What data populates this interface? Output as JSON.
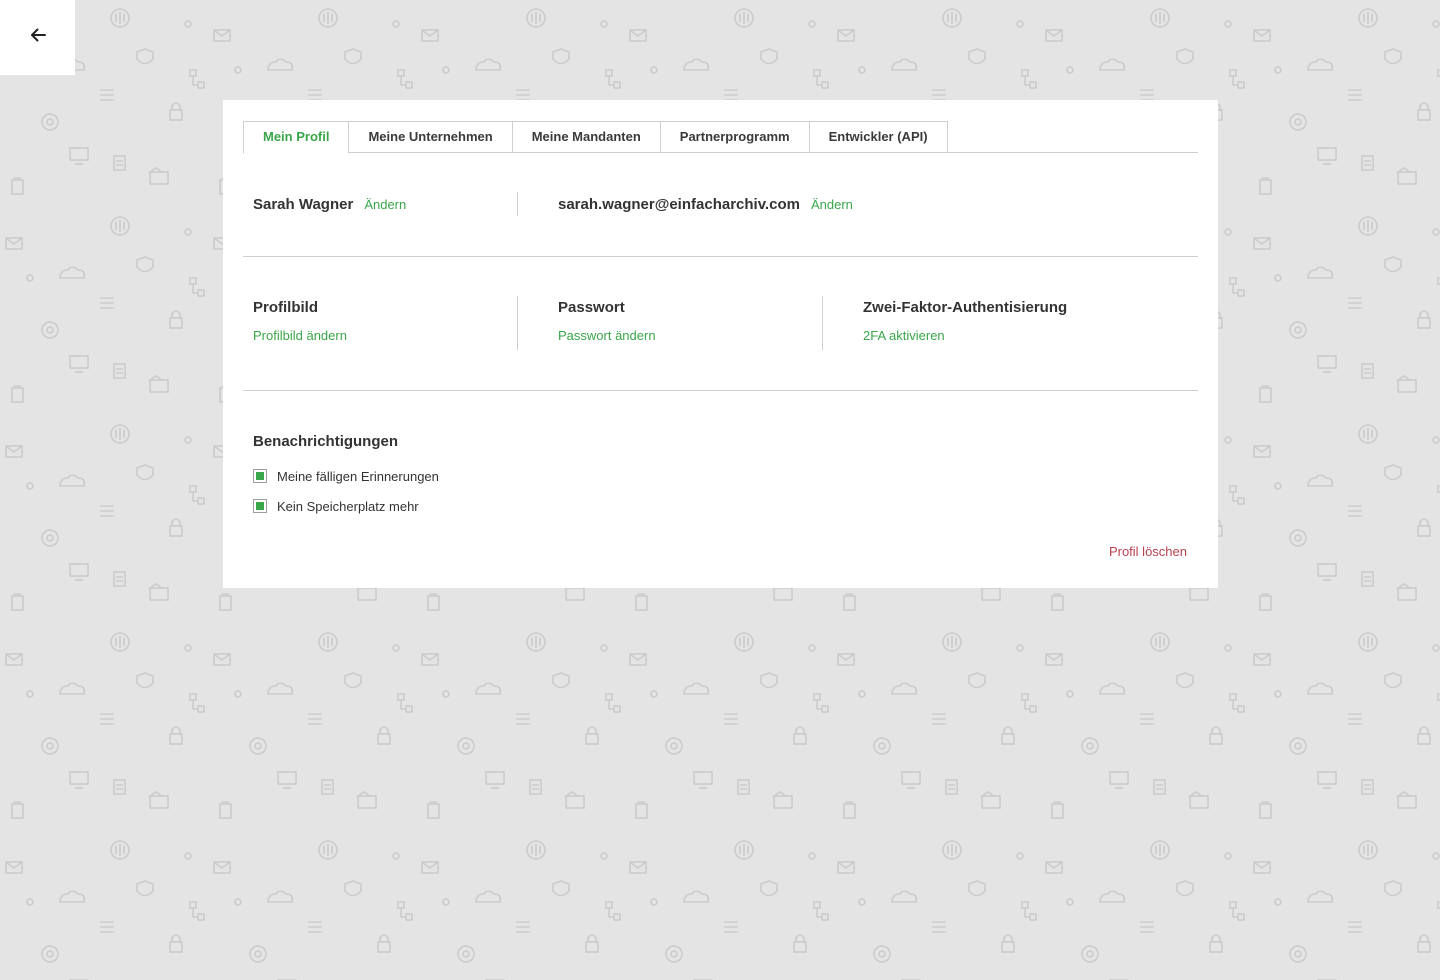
{
  "nav": {
    "back_icon": "arrow-left-icon"
  },
  "tabs": [
    {
      "label": "Mein Profil",
      "active": true
    },
    {
      "label": "Meine Unternehmen",
      "active": false
    },
    {
      "label": "Meine Mandanten",
      "active": false
    },
    {
      "label": "Partnerprogramm",
      "active": false
    },
    {
      "label": "Entwickler (API)",
      "active": false
    }
  ],
  "profile": {
    "name": "Sarah Wagner",
    "name_edit_label": "Ändern",
    "email": "sarah.wagner@einfacharchiv.com",
    "email_edit_label": "Ändern"
  },
  "settings": {
    "picture": {
      "title": "Profilbild",
      "action": "Profilbild ändern"
    },
    "password": {
      "title": "Passwort",
      "action": "Passwort ändern"
    },
    "twofa": {
      "title": "Zwei-Faktor-Authentisierung",
      "action": "2FA aktivieren"
    }
  },
  "notifications": {
    "title": "Benachrichtigungen",
    "items": [
      {
        "label": "Meine fälligen Erinnerungen",
        "checked": true
      },
      {
        "label": "Kein Speicherplatz mehr",
        "checked": true
      }
    ]
  },
  "danger": {
    "delete_label": "Profil löschen"
  },
  "colors": {
    "accent": "#3aa64a",
    "danger": "#b8404f",
    "background": "#e4e4e4",
    "pattern_icon": "#c9c9c9"
  }
}
